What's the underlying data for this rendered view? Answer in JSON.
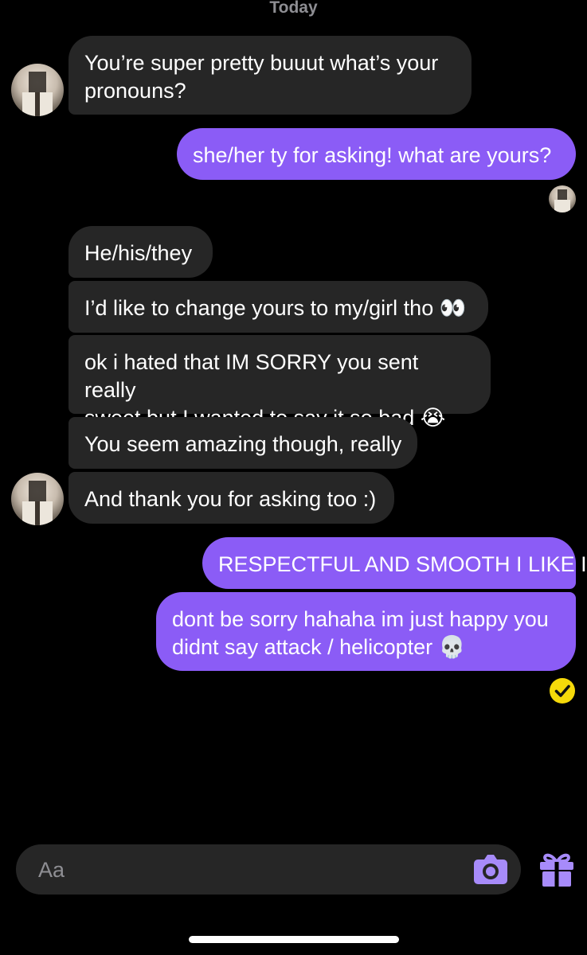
{
  "conversation": {
    "date_label": "Today",
    "messages": [
      {
        "from": "them",
        "text": "You’re super pretty buuut what’s your\npronouns?"
      },
      {
        "from": "me",
        "text": "she/her ty for asking! what are yours?"
      },
      {
        "from": "them",
        "text": "He/his/they"
      },
      {
        "from": "them",
        "text": "I’d like to change yours to my/girl tho 👀"
      },
      {
        "from": "them",
        "text": "ok i hated that IM SORRY you sent really\nsweet but I wanted to say it so bad 😭"
      },
      {
        "from": "them",
        "text": "You seem amazing though, really"
      },
      {
        "from": "them",
        "text": "And thank you for asking too :)"
      },
      {
        "from": "me",
        "text": "RESPECTFUL AND SMOOTH I LIKE IT"
      },
      {
        "from": "me",
        "text": "dont be sorry hahaha im just happy you\ndidnt say attack / helicopter 💀"
      }
    ]
  },
  "composer": {
    "placeholder": "Aa",
    "camera_icon": "camera-icon",
    "gift_icon": "gift-icon"
  },
  "status": {
    "read_receipt_icon": "check-circle-icon"
  },
  "colors": {
    "outgoing_bubble": "#8b5cf6",
    "incoming_bubble": "#262626",
    "accent_icon": "#a78bfa",
    "read_receipt": "#f5d90a",
    "background": "#000000"
  }
}
